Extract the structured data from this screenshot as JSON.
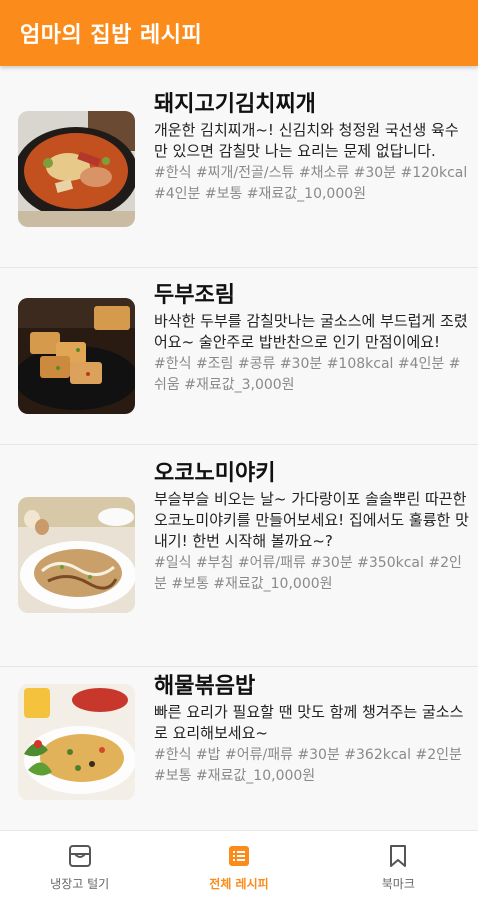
{
  "app": {
    "title": "엄마의 집밥 레시피"
  },
  "recipes": [
    {
      "title": "돼지고기김치찌개",
      "description": "개운한 김치찌개~! 신김치와 청정원 국선생 육수만  있으면 감칠맛 나는 요리는 문제 없답니다.",
      "tags": "#한식 #찌개/전골/스튜 #채소류 #30분 #120kcal #4인분 #보통 #재료값_10,000원",
      "image": "kimchi-stew-photo"
    },
    {
      "title": "두부조림",
      "description": "바삭한 두부를 감칠맛나는 굴소스에 부드럽게 조렸어요~ 술안주로 밥반찬으로 인기 만점이에요!",
      "tags": "#한식 #조림 #콩류 #30분 #108kcal #4인분 #쉬움 #재료값_3,000원",
      "image": "braised-tofu-photo"
    },
    {
      "title": "오코노미야키",
      "description": "부슬부슬 비오는 날~ 가다랑이포 솔솔뿌린 따끈한 오코노미야키를 만들어보세요! 집에서도 훌륭한 맛내기! 한번 시작해 볼까요~?",
      "tags": "#일식 #부침 #어류/패류 #30분 #350kcal #2인분 #보통 #재료값_10,000원",
      "image": "okonomiyaki-photo"
    },
    {
      "title": "해물볶음밥",
      "description": "빠른 요리가 필요할 땐 맛도 함께 챙겨주는 굴소스로 요리해보세요~",
      "tags": "#한식 #밥 #어류/패류 #30분 #362kcal #2인분 #보통 #재료값_10,000원",
      "image": "seafood-fried-rice-photo"
    }
  ],
  "bottom_nav": {
    "items": [
      {
        "label": "냉장고 털기",
        "icon": "fridge-box-icon",
        "active": false
      },
      {
        "label": "전체 레시피",
        "icon": "recipe-list-icon",
        "active": true
      },
      {
        "label": "북마크",
        "icon": "bookmark-icon",
        "active": false
      }
    ]
  },
  "colors": {
    "accent": "#fb8c1b",
    "background": "#f8f8f8",
    "tag_text": "#8a8a8a",
    "nav_inactive": "#666666"
  }
}
